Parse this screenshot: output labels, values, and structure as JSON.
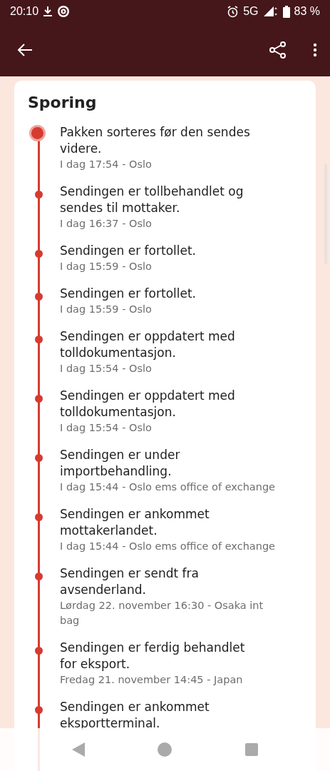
{
  "status_bar": {
    "time": "20:10",
    "network": "5G",
    "battery": "83 %"
  },
  "card": {
    "title": "Sporing"
  },
  "events": [
    {
      "text": "Pakken sorteres før den sendes videre.",
      "meta": "I dag 17:54 - Oslo",
      "current": true
    },
    {
      "text": "Sendingen er tollbehandlet og sendes til mottaker.",
      "meta": "I dag 16:37 - Oslo",
      "current": false
    },
    {
      "text": "Sendingen er fortollet.",
      "meta": "I dag 15:59 - Oslo",
      "current": false
    },
    {
      "text": "Sendingen er fortollet.",
      "meta": "I dag 15:59 - Oslo",
      "current": false
    },
    {
      "text": "Sendingen er oppdatert med tolldokumentasjon.",
      "meta": "I dag 15:54 - Oslo",
      "current": false
    },
    {
      "text": "Sendingen er oppdatert med tolldokumentasjon.",
      "meta": "I dag 15:54 - Oslo",
      "current": false
    },
    {
      "text": "Sendingen er under importbehandling.",
      "meta": "I dag 15:44 - Oslo ems office of exchange",
      "current": false
    },
    {
      "text": "Sendingen er ankommet mottakerlandet.",
      "meta": "I dag 15:44 - Oslo ems office of exchange",
      "current": false
    },
    {
      "text": "Sendingen er sendt fra avsenderland.",
      "meta": "Lørdag 22. november 16:30 - Osaka int bag",
      "current": false
    },
    {
      "text": "Sendingen er ferdig behandlet for eksport.",
      "meta": "Fredag 21. november 14:45 - Japan",
      "current": false
    },
    {
      "text": "Sendingen er ankommet eksportterminal.",
      "current": false
    }
  ]
}
